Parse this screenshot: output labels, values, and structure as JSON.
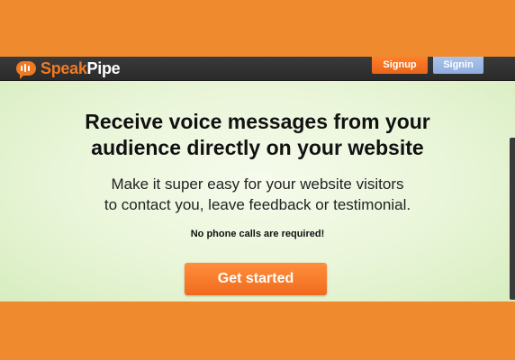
{
  "colors": {
    "frame": "#f08a2e",
    "topbar": "#2f2f2f",
    "brand_orange": "#f07a22",
    "signin_blue": "#9bb8e5",
    "hero_bg": "#e6f4d4"
  },
  "header": {
    "logo_word_1": "Speak",
    "logo_word_2": "Pipe",
    "logo_icon": "speech-bubble-soundwave-icon",
    "signup_label": "Signup",
    "signin_label": "Signin"
  },
  "hero": {
    "headline_line1": "Receive voice messages from your",
    "headline_line2": "audience directly on your website",
    "subline_line1": "Make it super easy for your website visitors",
    "subline_line2": "to contact you, leave feedback or testimonial.",
    "note": "No phone calls are required!",
    "cta_label": "Get started"
  }
}
